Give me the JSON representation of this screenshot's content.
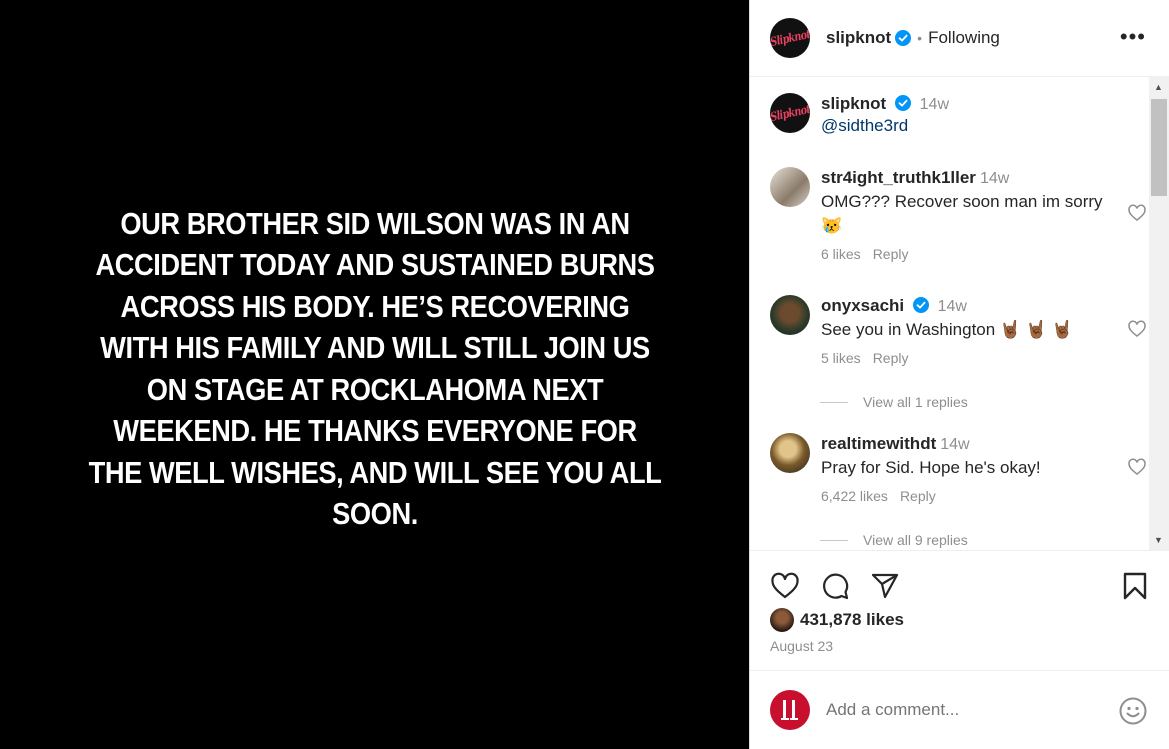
{
  "post": {
    "image_text": "OUR BROTHER SID WILSON WAS IN AN ACCIDENT TODAY AND SUSTAINED BURNS ACROSS HIS BODY. HE’S RECOVERING WITH HIS FAMILY AND WILL STILL JOIN US ON STAGE AT ROCKLAHOMA NEXT WEEKEND. HE THANKS EVERYONE FOR THE WELL WISHES, AND WILL SEE YOU ALL SOON."
  },
  "header": {
    "logo_text": "Slipknot",
    "username": "slipknot",
    "separator": "•",
    "following_label": "Following",
    "more_label": "•••"
  },
  "caption": {
    "username": "slipknot",
    "time": "14w",
    "text": "@sidthe3rd"
  },
  "comments": [
    {
      "username": "str4ight_truthk1ller",
      "time": "14w",
      "text": "OMG??? Recover soon man im sorry 😿",
      "likes": "6 likes",
      "reply": "Reply"
    },
    {
      "username": "onyxsachi",
      "time": "14w",
      "text": "See you in Washington 🤘🏾 🤘🏾 🤘🏾",
      "likes": "5 likes",
      "reply": "Reply",
      "view_replies": "View all 1 replies"
    },
    {
      "username": "realtimewithdt",
      "time": "14w",
      "text": "Pray for Sid. Hope he's okay!",
      "likes": "6,422 likes",
      "reply": "Reply",
      "view_replies": "View all 9 replies"
    }
  ],
  "footer": {
    "likes": "431,878 likes",
    "date": "August 23",
    "add_comment_placeholder": "Add a comment..."
  },
  "colors": {
    "verified": "#0095f6",
    "link": "#00376b",
    "muted": "#8e8e8e"
  },
  "icons": [
    "heart-icon",
    "comment-icon",
    "share-icon",
    "bookmark-icon",
    "emoji-icon",
    "verified-icon",
    "more-icon"
  ]
}
